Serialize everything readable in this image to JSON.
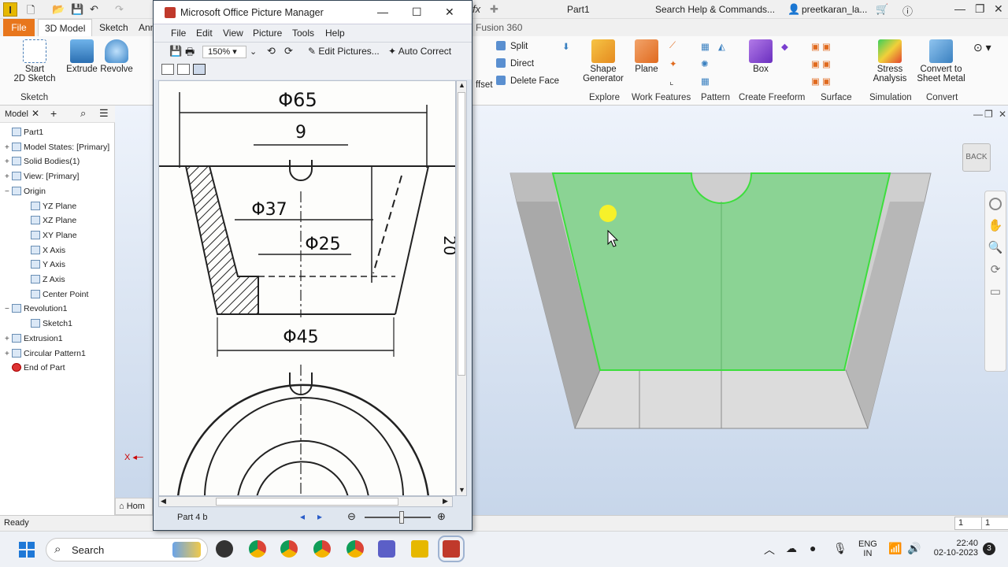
{
  "inventor": {
    "doc_name": "Part1",
    "search_help": "Search Help & Commands...",
    "user": "preetkaran_la...",
    "tabs": [
      "File",
      "3D Model",
      "Sketch",
      "Ann",
      "Fusion 360"
    ],
    "ribbon": {
      "start_sketch": "Start\n2D Sketch",
      "start_sketch_l1": "Start",
      "start_sketch_l2": "2D Sketch",
      "extrude": "Extrude",
      "revolve": "Revolve",
      "split": "Split",
      "direct": "Direct",
      "offset_partial": "ffset",
      "delete_face": "Delete Face",
      "shape_gen_l1": "Shape",
      "shape_gen_l2": "Generator",
      "plane": "Plane",
      "box": "Box",
      "stress_l1": "Stress",
      "stress_l2": "Analysis",
      "convert_l1": "Convert to",
      "convert_l2": "Sheet Metal",
      "groups": {
        "sketch": "Sketch",
        "explore": "Explore",
        "work_features": "Work Features",
        "pattern": "Pattern",
        "create_freeform": "Create Freeform",
        "surface": "Surface",
        "simulation": "Simulation",
        "convert": "Convert"
      }
    },
    "browser": {
      "tab_label": "Model",
      "items": [
        {
          "label": "Part1",
          "exp": "",
          "indent": 0
        },
        {
          "label": "Model States: [Primary]",
          "exp": "+",
          "indent": 0
        },
        {
          "label": "Solid Bodies(1)",
          "exp": "+",
          "indent": 0
        },
        {
          "label": "View: [Primary]",
          "exp": "+",
          "indent": 0
        },
        {
          "label": "Origin",
          "exp": "−",
          "indent": 0
        },
        {
          "label": "YZ Plane",
          "exp": "",
          "indent": 1
        },
        {
          "label": "XZ Plane",
          "exp": "",
          "indent": 1
        },
        {
          "label": "XY Plane",
          "exp": "",
          "indent": 1
        },
        {
          "label": "X Axis",
          "exp": "",
          "indent": 1
        },
        {
          "label": "Y Axis",
          "exp": "",
          "indent": 1
        },
        {
          "label": "Z Axis",
          "exp": "",
          "indent": 1
        },
        {
          "label": "Center Point",
          "exp": "",
          "indent": 1
        },
        {
          "label": "Revolution1",
          "exp": "−",
          "indent": 0
        },
        {
          "label": "Sketch1",
          "exp": "",
          "indent": 1
        },
        {
          "label": "Extrusion1",
          "exp": "+",
          "indent": 0
        },
        {
          "label": "Circular Pattern1",
          "exp": "+",
          "indent": 0
        },
        {
          "label": "End of Part",
          "exp": "",
          "indent": 0
        }
      ]
    },
    "home_partial": "Hom",
    "back_button": "BACK",
    "status_text": "Ready",
    "status_counts": [
      "1",
      "1"
    ]
  },
  "picture_manager": {
    "title": "Microsoft Office Picture Manager",
    "menus": [
      "File",
      "Edit",
      "View",
      "Picture",
      "Tools",
      "Help"
    ],
    "zoom": "150%",
    "edit_pictures": "Edit Pictures...",
    "auto_correct": "Auto Correct",
    "file_label": "Part 4 b",
    "drawing_labels": {
      "d65": "Φ65",
      "nine": "9",
      "d37": "Φ37",
      "d25": "Φ25",
      "d45": "Φ45",
      "side": "20"
    }
  },
  "taskbar": {
    "search": "Search",
    "lang_l1": "ENG",
    "lang_l2": "IN",
    "time": "22:40",
    "date": "02-10-2023",
    "badge": "3"
  },
  "colors": {
    "accent_orange": "#e8761c",
    "highlight_green": "#7fd38a",
    "highlight_edge": "#3dde3d"
  }
}
